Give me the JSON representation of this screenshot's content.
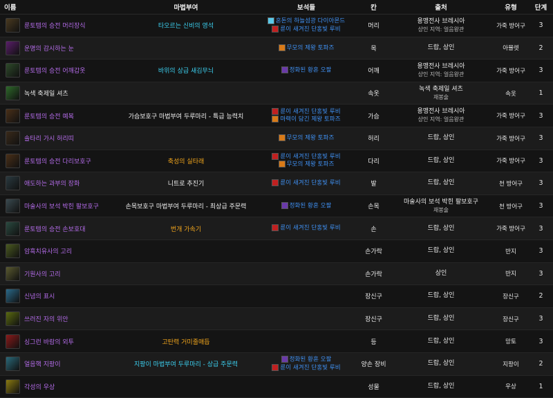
{
  "headers": {
    "name": "이름",
    "ench": "마법부여",
    "gems": "보석들",
    "slot": "칸",
    "source": "출처",
    "type": "유형",
    "stage": "단계"
  },
  "colors": {
    "epic": "#b36be8",
    "enchant_cyan": "#3cd0f0",
    "enchant_orange": "#f2a61c",
    "gem_blue": "#3f8ff0"
  },
  "rows": [
    {
      "icon": "shoulder-armor-icon",
      "color": "#4a3a20",
      "name": "룬토템의 승전 머리장식",
      "ench": "타오르는 신비의 영석",
      "enchClass": "ench-a",
      "gems": [
        "혼돈의 하늘섬광 다이아몬드",
        "룬이 새겨진 단홍빛 루비"
      ],
      "slot": "머리",
      "source": "용맹전사 브레시아",
      "sourceSub": "상인 지역: 얼음왕관",
      "type": "가죽 방어구",
      "stage": "3"
    },
    {
      "icon": "necklace-icon",
      "color": "#5a1e6a",
      "name": "운명의 감시하는 눈",
      "ench": "",
      "enchClass": "",
      "gems": [
        "무모의 제왕 토파즈"
      ],
      "slot": "목",
      "source": "드랍, 상인",
      "sourceSub": "",
      "type": "아뮬렛",
      "stage": "2"
    },
    {
      "icon": "shoulder-icon",
      "color": "#2e4a2a",
      "name": "룬토템의 승전 어깨갑옷",
      "ench": "바위의 상급 새김무늬",
      "enchClass": "ench-a",
      "gems": [
        "정화된 황혼 오팔"
      ],
      "slot": "어깨",
      "source": "용맹전사 브레시아",
      "sourceSub": "상인 지역: 얼음왕관",
      "type": "가죽 방어구",
      "stage": "3"
    },
    {
      "icon": "shirt-icon",
      "color": "#2e6a2a",
      "name": "녹색 축제일 셔츠",
      "ench": "",
      "enchClass": "",
      "gems": [],
      "slot": "속옷",
      "source": "녹색 축제일 셔츠",
      "sourceSub": "재봉술",
      "type": "속옷",
      "stage": "1",
      "white": true
    },
    {
      "icon": "chest-armor-icon",
      "color": "#4a3018",
      "name": "룬토템의 승전 예복",
      "ench": "가슴보호구 마법부여 두루마리 - 특급 능력치",
      "enchClass": "ench-b",
      "gems": [
        "룬이 새겨진 단홍빛 루비",
        "마력이 담긴 제왕 토파즈"
      ],
      "slot": "가슴",
      "source": "용맹전사 브레시아",
      "sourceSub": "상인 지역: 얼음왕관",
      "type": "가죽 방어구",
      "stage": "3"
    },
    {
      "icon": "belt-icon",
      "color": "#3a2a1a",
      "name": "솔타리 가시 허리띠",
      "ench": "",
      "enchClass": "",
      "gems": [
        "무모의 제왕 토파즈"
      ],
      "slot": "허리",
      "source": "드랍, 상인",
      "sourceSub": "",
      "type": "가죽 방어구",
      "stage": "3"
    },
    {
      "icon": "legs-armor-icon",
      "color": "#4a3018",
      "name": "룬토템의 승전 다리보호구",
      "ench": "축성의 실타래",
      "enchClass": "ench-c",
      "gems": [
        "룬이 새겨진 단홍빛 루비",
        "무모의 제왕 토파즈"
      ],
      "slot": "다리",
      "source": "드랍, 상인",
      "sourceSub": "",
      "type": "가죽 방어구",
      "stage": "3"
    },
    {
      "icon": "boots-icon",
      "color": "#2a3a40",
      "name": "애도하는 과부의 장화",
      "ench": "니트로 추진기",
      "enchClass": "ench-b",
      "gems": [
        "룬이 새겨진 단홍빛 루비"
      ],
      "slot": "발",
      "source": "드랍, 상인",
      "sourceSub": "",
      "type": "천 방어구",
      "stage": "3"
    },
    {
      "icon": "bracer-icon",
      "color": "#3a4a50",
      "name": "마술사의 보석 박힌 팔보호구",
      "ench": "손목보호구 마법부여 두루마리 - 최상급 주문력",
      "enchClass": "ench-b",
      "gems": [
        "정화된 황혼 오팔"
      ],
      "slot": "손목",
      "source": "마술사의 보석 박힌 팔보호구",
      "sourceSub": "재봉술",
      "type": "천 방어구",
      "stage": "3"
    },
    {
      "icon": "gloves-icon",
      "color": "#2a4a40",
      "name": "룬토템의 승전 손보호대",
      "ench": "번개 가속기",
      "enchClass": "ench-c",
      "gems": [
        "룬이 새겨진 단홍빛 루비"
      ],
      "slot": "손",
      "source": "드랍, 상인",
      "sourceSub": "",
      "type": "가죽 방어구",
      "stage": "3"
    },
    {
      "icon": "ring-icon",
      "color": "#4a5a20",
      "name": "암흑치유사의 고리",
      "ench": "",
      "enchClass": "",
      "gems": [],
      "slot": "손가락",
      "source": "드랍, 상인",
      "sourceSub": "",
      "type": "반지",
      "stage": "3"
    },
    {
      "icon": "ring-icon",
      "color": "#5a5a30",
      "name": "기원사의 고리",
      "ench": "",
      "enchClass": "",
      "gems": [],
      "slot": "손가락",
      "source": "상인",
      "sourceSub": "",
      "type": "반지",
      "stage": "3"
    },
    {
      "icon": "trinket-icon",
      "color": "#2a6a8a",
      "name": "신념의 표시",
      "ench": "",
      "enchClass": "",
      "gems": [],
      "slot": "장신구",
      "source": "드랍, 상인",
      "sourceSub": "",
      "type": "장신구",
      "stage": "2"
    },
    {
      "icon": "trinket-icon",
      "color": "#5a6a10",
      "name": "쓰러진 자의 위안",
      "ench": "",
      "enchClass": "",
      "gems": [],
      "slot": "장신구",
      "source": "드랍, 상인",
      "sourceSub": "",
      "type": "장신구",
      "stage": "3"
    },
    {
      "icon": "cloak-icon",
      "color": "#8a1a1a",
      "name": "싱그런 바람의 외투",
      "ench": "고탄력 거미줄매듭",
      "enchClass": "ench-c",
      "gems": [],
      "slot": "등",
      "source": "드랍, 상인",
      "sourceSub": "",
      "type": "망토",
      "stage": "3"
    },
    {
      "icon": "staff-icon",
      "color": "#2a6a7a",
      "name": "얼음핵 지팡이",
      "ench": "지팡이 마법부여 두루마리 - 상급 주문력",
      "enchClass": "ench-a",
      "gems": [
        "정화된 황혼 오팔",
        "룬이 새겨진 단홍빛 루비"
      ],
      "slot": "양손 장비",
      "source": "드랍, 상인",
      "sourceSub": "",
      "type": "지팡이",
      "stage": "2"
    },
    {
      "icon": "idol-icon",
      "color": "#8a7a10",
      "name": "각성의 우상",
      "ench": "",
      "enchClass": "",
      "gems": [],
      "slot": "성물",
      "source": "드랍, 상인",
      "sourceSub": "",
      "type": "우상",
      "stage": "1"
    }
  ]
}
